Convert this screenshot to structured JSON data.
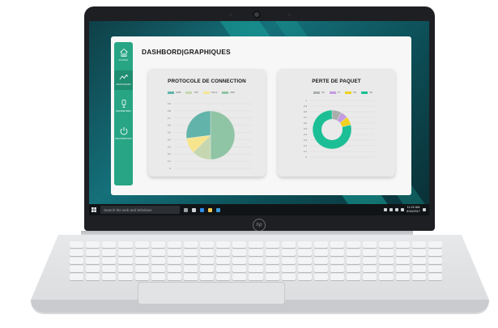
{
  "app": {
    "title": "DASHBORD|GRAPHIQUES",
    "nav": [
      {
        "label": "ACCUEIL",
        "icon": "home-icon",
        "active": false
      },
      {
        "label": "GRAPHIQUES",
        "icon": "chart-line-icon",
        "active": true
      },
      {
        "label": "PARAMETRES",
        "icon": "sensor-icon",
        "active": false
      },
      {
        "label": "DECONNEXION",
        "icon": "power-icon",
        "active": false
      }
    ]
  },
  "taskbar": {
    "search_placeholder": "Search the web and Windows",
    "time": "11:22 AM",
    "date": "6/16/2017"
  },
  "colors": {
    "sidebar": "#27a584",
    "teal": "#62b3a9",
    "green": "#8fc4a4",
    "sage": "#c6d7b0",
    "yellow": "#f7e58e",
    "gray": "#a9adac",
    "purple": "#c49be0",
    "yellow2": "#f0d020",
    "donut_main": "#1cbf95"
  },
  "chart_data": [
    {
      "type": "pie",
      "title": "PROTOCOLE DE CONNECTION",
      "legend": [
        "ICMP",
        "TCP",
        "TCH-2",
        "UDP"
      ],
      "legend_colors": [
        "#62b3a9",
        "#c6d7b0",
        "#f7e58e",
        "#8fc4a4"
      ],
      "slices": [
        {
          "value": 0.5,
          "color": "#8fc4a4"
        },
        {
          "value": 0.125,
          "color": "#c6d7b0"
        },
        {
          "value": 0.105,
          "color": "#f7e58e"
        },
        {
          "value": 0.27,
          "color": "#62b3a9"
        }
      ],
      "yticks": [
        "0.9",
        "0.8",
        "0.7",
        "0.6",
        "0.5",
        "0.4",
        "0.3",
        "0.2",
        "0.1",
        "0"
      ]
    },
    {
      "type": "pie",
      "donut": true,
      "title": "PERTE DE PAQUET",
      "legend": [
        "SN",
        "VT",
        "TCI",
        "SN"
      ],
      "legend_colors": [
        "#a9adac",
        "#c49be0",
        "#f0d020",
        "#1cbf95"
      ],
      "slices": [
        {
          "value": 0.08,
          "color": "#a9adac"
        },
        {
          "value": 0.06,
          "color": "#c49be0"
        },
        {
          "value": 0.07,
          "color": "#f0d020"
        },
        {
          "value": 0.79,
          "color": "#1cbf95"
        }
      ],
      "yticks": [
        "1",
        "0.9",
        "0.8",
        "0.7",
        "0.6",
        "0.5",
        "0.4",
        "0.3",
        "0.2",
        "0.1",
        "0"
      ]
    }
  ]
}
